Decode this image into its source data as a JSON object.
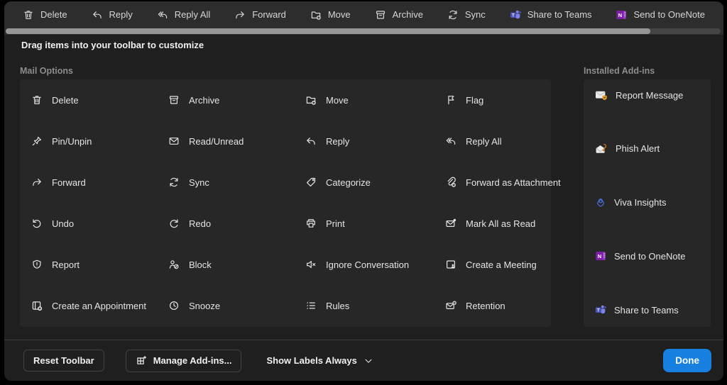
{
  "instruction": "Drag items into your toolbar to customize",
  "toolbar": {
    "items": [
      {
        "label": "Delete",
        "icon": "trash-icon"
      },
      {
        "label": "Reply",
        "icon": "reply-icon"
      },
      {
        "label": "Reply All",
        "icon": "reply-all-icon"
      },
      {
        "label": "Forward",
        "icon": "forward-icon"
      },
      {
        "label": "Move",
        "icon": "move-folder-icon"
      },
      {
        "label": "Archive",
        "icon": "archive-icon"
      },
      {
        "label": "Sync",
        "icon": "sync-icon"
      },
      {
        "label": "Share to Teams",
        "icon": "teams-logo-icon"
      },
      {
        "label": "Send to OneNote",
        "icon": "onenote-logo-icon"
      }
    ]
  },
  "mail_options": {
    "title": "Mail Options",
    "items": [
      {
        "label": "Delete",
        "icon": "trash-icon"
      },
      {
        "label": "Archive",
        "icon": "archive-icon"
      },
      {
        "label": "Move",
        "icon": "move-folder-icon"
      },
      {
        "label": "Flag",
        "icon": "flag-icon"
      },
      {
        "label": "Pin/Unpin",
        "icon": "pin-icon"
      },
      {
        "label": "Read/Unread",
        "icon": "envelope-icon"
      },
      {
        "label": "Reply",
        "icon": "reply-icon"
      },
      {
        "label": "Reply All",
        "icon": "reply-all-icon"
      },
      {
        "label": "Forward",
        "icon": "forward-icon"
      },
      {
        "label": "Sync",
        "icon": "sync-icon"
      },
      {
        "label": "Categorize",
        "icon": "tag-icon"
      },
      {
        "label": "Forward as Attachment",
        "icon": "attachment-forward-icon"
      },
      {
        "label": "Undo",
        "icon": "undo-icon"
      },
      {
        "label": "Redo",
        "icon": "redo-icon"
      },
      {
        "label": "Print",
        "icon": "printer-icon"
      },
      {
        "label": "Mark All as Read",
        "icon": "mail-read-dot-icon"
      },
      {
        "label": "Report",
        "icon": "shield-report-icon"
      },
      {
        "label": "Block",
        "icon": "person-block-icon"
      },
      {
        "label": "Ignore Conversation",
        "icon": "mute-speaker-icon"
      },
      {
        "label": "Create a Meeting",
        "icon": "meeting-person-icon"
      },
      {
        "label": "Create an Appointment",
        "icon": "appointment-add-icon"
      },
      {
        "label": "Snooze",
        "icon": "clock-icon"
      },
      {
        "label": "Rules",
        "icon": "rules-list-icon"
      },
      {
        "label": "Retention",
        "icon": "mail-retention-icon"
      }
    ]
  },
  "installed_addins": {
    "title": "Installed Add-ins",
    "items": [
      {
        "label": "Report Message",
        "icon": "report-message-addin-icon"
      },
      {
        "label": "Phish Alert",
        "icon": "phish-alert-addin-icon"
      },
      {
        "label": "Viva Insights",
        "icon": "viva-insights-logo-icon"
      },
      {
        "label": "Send to OneNote",
        "icon": "onenote-logo-icon"
      },
      {
        "label": "Share to Teams",
        "icon": "teams-logo-icon"
      }
    ]
  },
  "footer": {
    "reset": "Reset Toolbar",
    "manage": "Manage Add-ins...",
    "show_labels": "Show Labels Always",
    "done": "Done"
  },
  "colors": {
    "accent_blue": "#1780e0",
    "page_bg": "#1f1f1f",
    "panel_bg": "#272727",
    "toolbar_bg": "#2d2d2d",
    "teams_purple": "#4b53bc",
    "onenote_purple": "#7b1fa6",
    "addin_orange": "#e59b2c",
    "viva_blue": "#4671e0"
  }
}
